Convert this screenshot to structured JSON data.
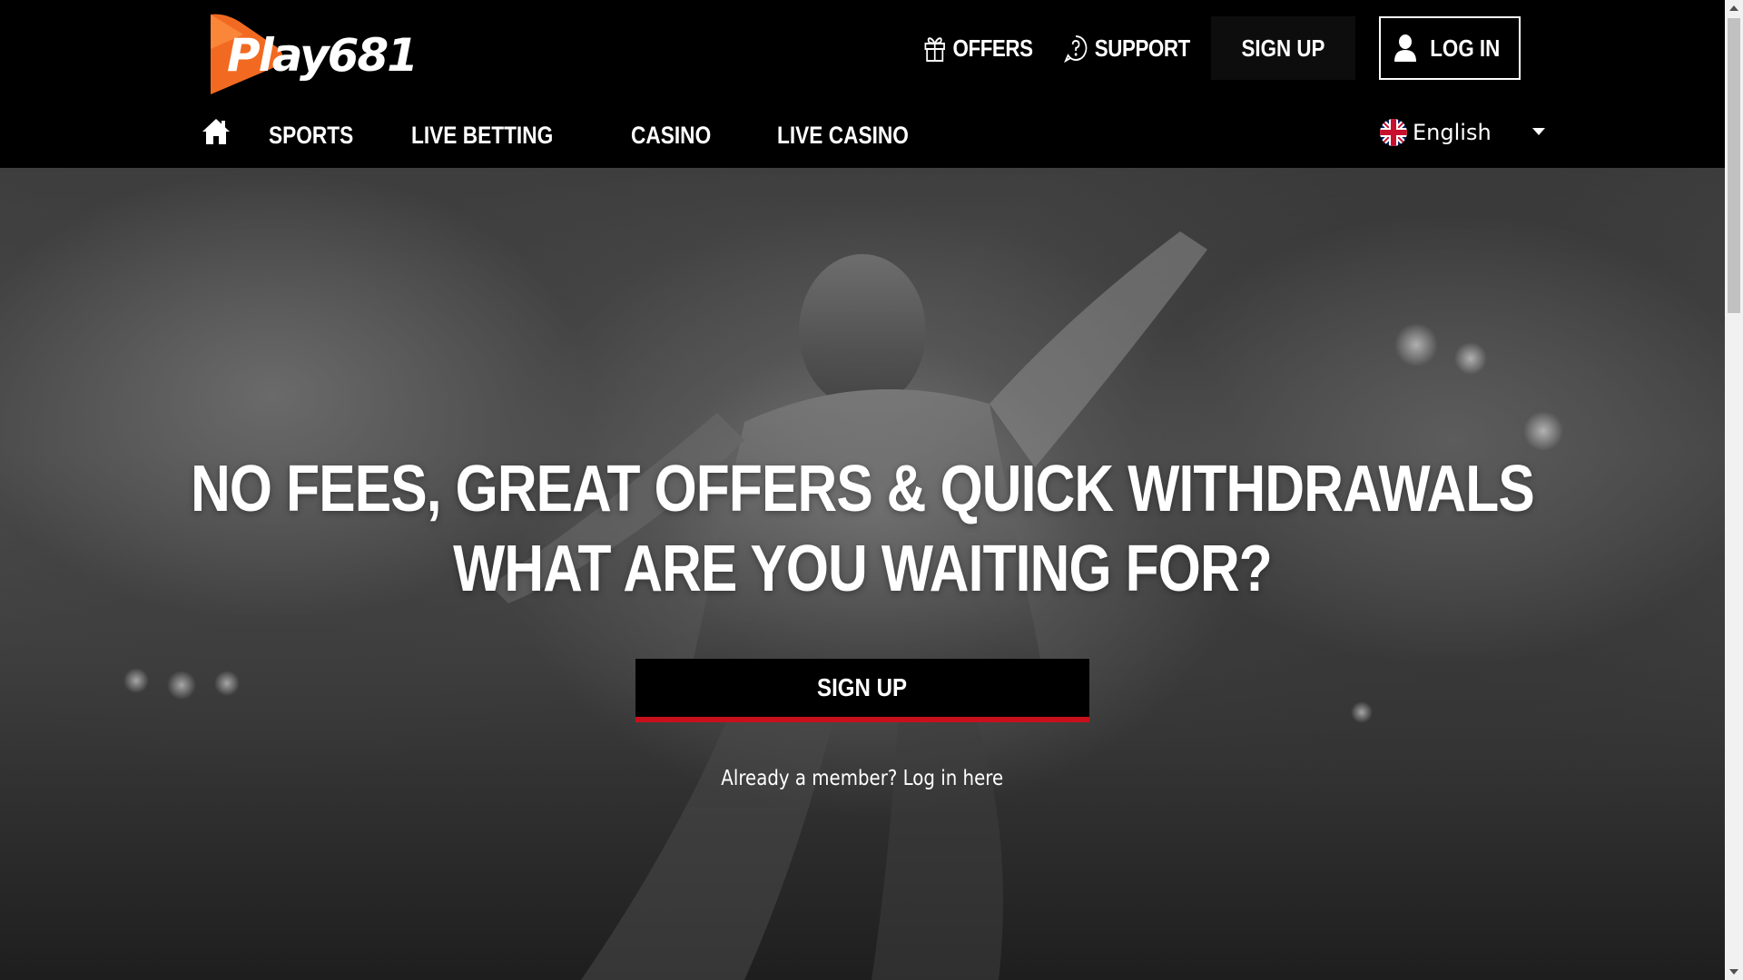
{
  "brand": {
    "logo_text": "Play681",
    "colors": {
      "logo_orange": "#f26a21",
      "accent_red": "#c8101c",
      "background": "#000000"
    }
  },
  "header": {
    "offers_label": "OFFERS",
    "support_label": "SUPPORT",
    "signup_label": "SIGN UP",
    "login_label": "LOG IN",
    "icons": {
      "offers": "gift-icon",
      "support": "question-circle-icon",
      "login": "user-icon"
    }
  },
  "nav": {
    "home_icon": "home-icon",
    "items": [
      {
        "label": "SPORTS"
      },
      {
        "label": "LIVE BETTING"
      },
      {
        "label": "CASINO"
      },
      {
        "label": "LIVE CASINO"
      }
    ],
    "language": {
      "label": "English",
      "flag_icon": "uk-flag-icon",
      "caret_icon": "caret-down-icon"
    }
  },
  "hero": {
    "headline_line1": "NO FEES, GREAT OFFERS & QUICK WITHDRAWALS",
    "headline_line2": "WHAT ARE YOU WAITING FOR?",
    "signup_label": "SIGN UP",
    "login_prompt": "Already a member? Log in here"
  }
}
